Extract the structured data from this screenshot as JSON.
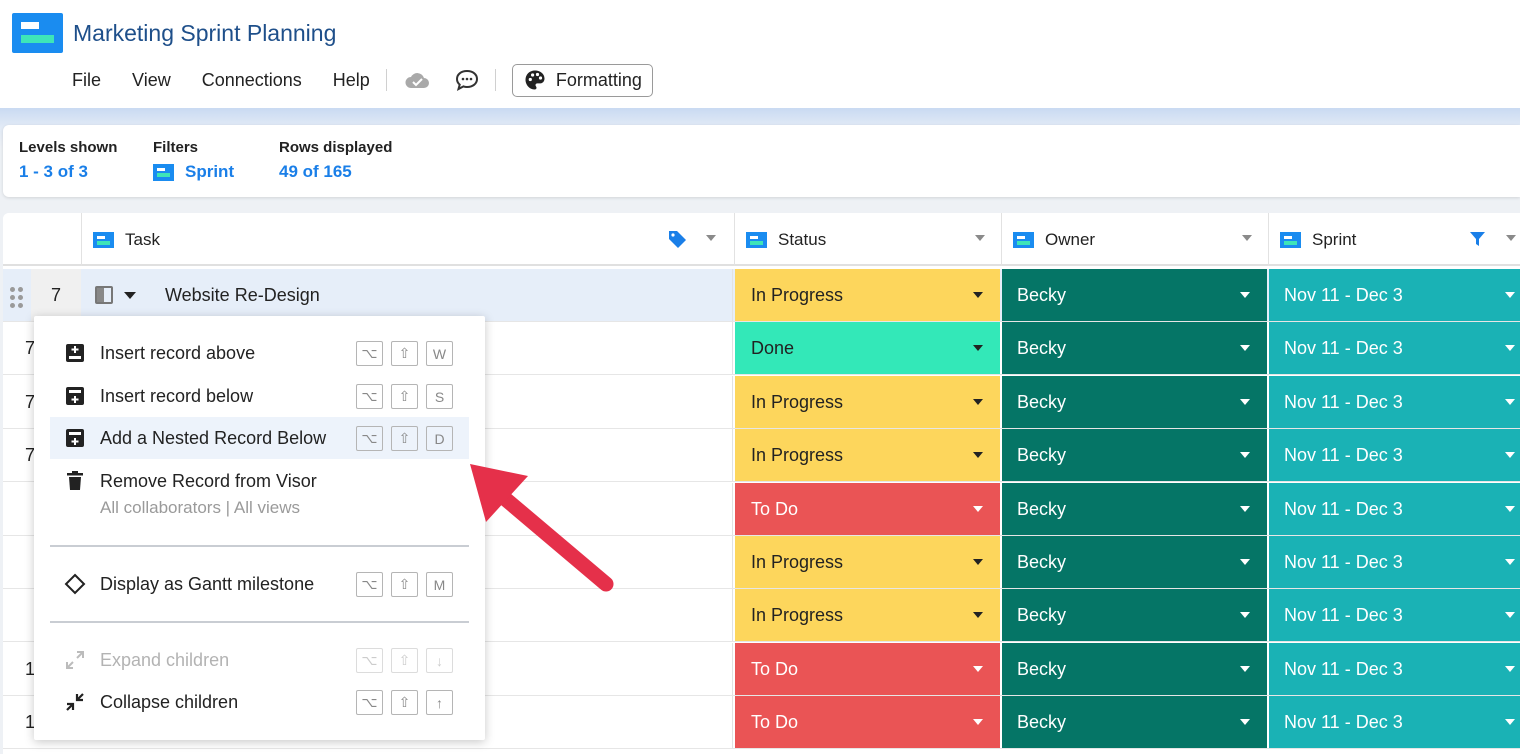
{
  "app": {
    "title": "Marketing Sprint Planning",
    "brand_color": "#1a8cf0"
  },
  "menu": {
    "file": "File",
    "view": "View",
    "connections": "Connections",
    "help": "Help",
    "cloud_icon": "cloud-icon",
    "comment_icon": "comment-icon",
    "formatting": "Formatting",
    "formatting_icon": "palette-icon"
  },
  "stats": {
    "levels_label": "Levels shown",
    "levels_value": "1 - 3 of 3",
    "filters_label": "Filters",
    "filters_value": "Sprint",
    "rows_label": "Rows displayed",
    "rows_value": "49 of 165"
  },
  "grid": {
    "columns": {
      "task": "Task",
      "status": "Status",
      "owner": "Owner",
      "sprint": "Sprint"
    },
    "first_row": {
      "number": "7",
      "task": "Website Re-Design"
    },
    "row_numbers_partial": [
      "7",
      "7",
      "7",
      "",
      "",
      "",
      "1",
      "1"
    ],
    "rows": [
      {
        "status": "In Progress",
        "owner": "Becky",
        "sprint": "Nov 11 - Dec 3"
      },
      {
        "status": "Done",
        "owner": "Becky",
        "sprint": "Nov 11 - Dec 3"
      },
      {
        "status": "In Progress",
        "owner": "Becky",
        "sprint": "Nov 11 - Dec 3"
      },
      {
        "status": "In Progress",
        "owner": "Becky",
        "sprint": "Nov 11 - Dec 3"
      },
      {
        "status": "To Do",
        "owner": "Becky",
        "sprint": "Nov 11 - Dec 3"
      },
      {
        "status": "In Progress",
        "owner": "Becky",
        "sprint": "Nov 11 - Dec 3"
      },
      {
        "status": "In Progress",
        "owner": "Becky",
        "sprint": "Nov 11 - Dec 3"
      },
      {
        "status": "To Do",
        "owner": "Becky",
        "sprint": "Nov 11 - Dec 3"
      },
      {
        "status": "To Do",
        "owner": "Becky",
        "sprint": "Nov 11 - Dec 3"
      }
    ],
    "status_colors": {
      "In Progress": "#fdd65c",
      "Done": "#33e8b8",
      "To Do": "#ea5455"
    },
    "owner_color": "#057566",
    "sprint_color": "#1ab2b5"
  },
  "context_menu": {
    "insert_above": "Insert record above",
    "insert_above_keys": [
      "⌥",
      "⇧",
      "W"
    ],
    "insert_below": "Insert record below",
    "insert_below_keys": [
      "⌥",
      "⇧",
      "S"
    ],
    "add_nested": "Add a Nested Record Below",
    "add_nested_keys": [
      "⌥",
      "⇧",
      "D"
    ],
    "remove": "Remove Record from Visor",
    "remove_sub": "All collaborators | All views",
    "milestone": "Display as Gantt milestone",
    "milestone_keys": [
      "⌥",
      "⇧",
      "M"
    ],
    "expand": "Expand children",
    "expand_keys": [
      "⌥",
      "⇧",
      "↓"
    ],
    "collapse": "Collapse children",
    "collapse_keys": [
      "⌥",
      "⇧",
      "↑"
    ]
  },
  "annotation": {
    "arrow_color": "#e5304a"
  }
}
